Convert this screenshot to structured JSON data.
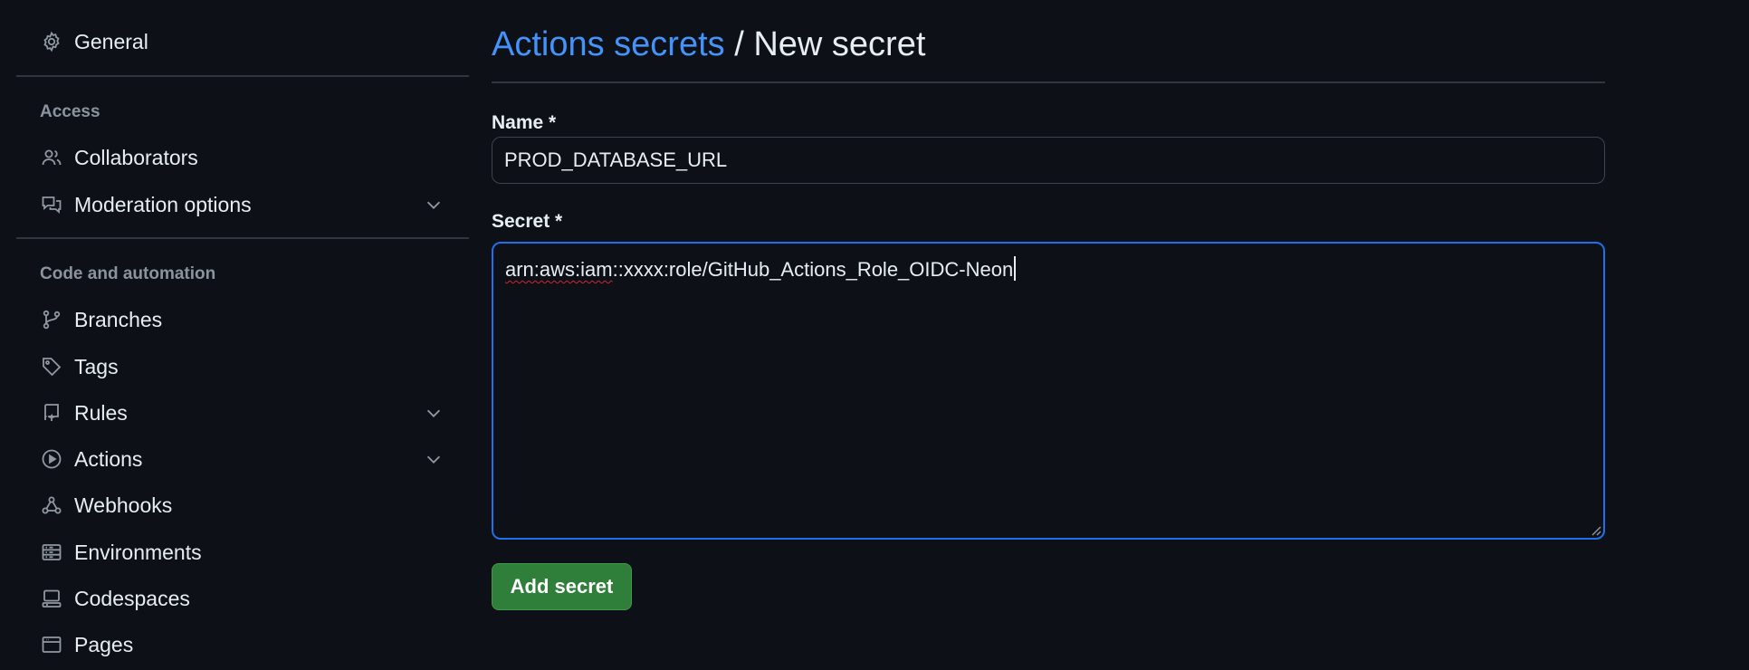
{
  "sidebar": {
    "general": {
      "label": "General",
      "icon": "gear-icon"
    },
    "access_heading": "Access",
    "access_items": [
      {
        "label": "Collaborators",
        "icon": "people-icon"
      },
      {
        "label": "Moderation options",
        "icon": "comment-discussion-icon",
        "expandable": true
      }
    ],
    "code_heading": "Code and automation",
    "code_items": [
      {
        "label": "Branches",
        "icon": "git-branch-icon"
      },
      {
        "label": "Tags",
        "icon": "tag-icon"
      },
      {
        "label": "Rules",
        "icon": "repo-push-icon",
        "expandable": true
      },
      {
        "label": "Actions",
        "icon": "play-icon",
        "expandable": true
      },
      {
        "label": "Webhooks",
        "icon": "webhook-icon"
      },
      {
        "label": "Environments",
        "icon": "server-icon"
      },
      {
        "label": "Codespaces",
        "icon": "codespaces-icon"
      },
      {
        "label": "Pages",
        "icon": "browser-icon"
      }
    ]
  },
  "page": {
    "breadcrumb_link": "Actions secrets",
    "separator": "/",
    "current": "New secret"
  },
  "form": {
    "name_label": "Name *",
    "name_value": "PROD_DATABASE_URL",
    "secret_label": "Secret *",
    "secret_value_flagged": "arn:aws:iam",
    "secret_value_rest": "::xxxx:role/GitHub_Actions_Role_OIDC-Neon",
    "submit_label": "Add secret"
  },
  "colors": {
    "background": "#0d1117",
    "link": "#4493f8",
    "focus_border": "#1f6feb",
    "button": "#2f7f3a",
    "muted": "#8b949e"
  }
}
